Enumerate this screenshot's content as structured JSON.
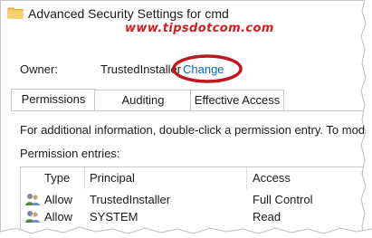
{
  "window": {
    "title": "Advanced Security Settings for cmd"
  },
  "watermark": "www.tipsdotcom.com",
  "owner": {
    "label": "Owner:",
    "value": "TrustedInstaller",
    "change_label": "Change"
  },
  "tabs": [
    {
      "label": "Permissions",
      "active": true
    },
    {
      "label": "Auditing",
      "active": false
    },
    {
      "label": "Effective Access",
      "active": false
    }
  ],
  "info_text": "For additional information, double-click a permission entry. To modify",
  "entries_label": "Permission entries:",
  "columns": [
    "Type",
    "Principal",
    "Access"
  ],
  "rows": [
    {
      "type": "Allow",
      "principal": "TrustedInstaller",
      "access": "Full Control"
    },
    {
      "type": "Allow",
      "principal": "SYSTEM",
      "access": "Read"
    }
  ],
  "colors": {
    "accent_link": "#0b63c5",
    "highlight": "#c0161e",
    "watermark": "#d11f1f"
  }
}
